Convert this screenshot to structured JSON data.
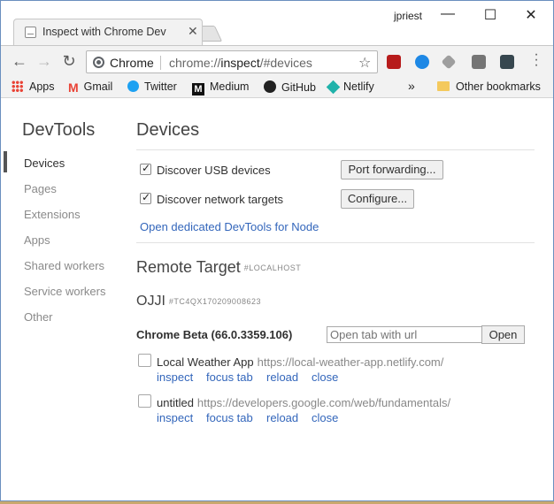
{
  "window": {
    "tab_title": "Inspect with Chrome Dev",
    "user": "jpriest",
    "controls": {
      "minimize": "—",
      "maximize": "☐",
      "close": "✕"
    }
  },
  "toolbar": {
    "back": "←",
    "forward": "→",
    "reload": "↻",
    "site_label": "Chrome",
    "url_prefix": "chrome://",
    "url_host": "inspect",
    "url_rest": "/#devices",
    "star": "☆",
    "extensions": [
      {
        "name": "ublock-extension-icon",
        "color": "#b71c1c"
      },
      {
        "name": "v-extension-icon",
        "color": "#1e88e5"
      },
      {
        "name": "drive-extension-icon",
        "color": "#9e9e9e"
      },
      {
        "name": "bookmark-extension-icon",
        "color": "#757575"
      },
      {
        "name": "u-extension-icon",
        "color": "#37474f"
      }
    ]
  },
  "bookmarks": {
    "items": [
      "Apps",
      "Gmail",
      "Twitter",
      "Medium",
      "GitHub",
      "Netlify"
    ],
    "overflow": "»",
    "other": "Other bookmarks"
  },
  "sidebar": {
    "title": "DevTools",
    "items": [
      "Devices",
      "Pages",
      "Extensions",
      "Apps",
      "Shared workers",
      "Service workers",
      "Other"
    ]
  },
  "devices": {
    "heading": "Devices",
    "discover_usb": "Discover USB devices",
    "port_forwarding": "Port forwarding...",
    "discover_network": "Discover network targets",
    "configure": "Configure...",
    "node_link": "Open dedicated DevTools for Node"
  },
  "remote": {
    "heading": "Remote Target",
    "subheading": "#LOCALHOST",
    "device_name": "OJJI",
    "device_serial": "#TC4QX170209008623",
    "browser": "Chrome Beta (66.0.3359.106)",
    "url_placeholder": "Open tab with url",
    "open_label": "Open",
    "pages": [
      {
        "title": "Local Weather App",
        "url": "https://local-weather-app.netlify.com/",
        "actions": [
          "inspect",
          "focus tab",
          "reload",
          "close"
        ]
      },
      {
        "title": "untitled",
        "url": "https://developers.google.com/web/fundamentals/",
        "actions": [
          "inspect",
          "focus tab",
          "reload",
          "close"
        ]
      }
    ]
  }
}
